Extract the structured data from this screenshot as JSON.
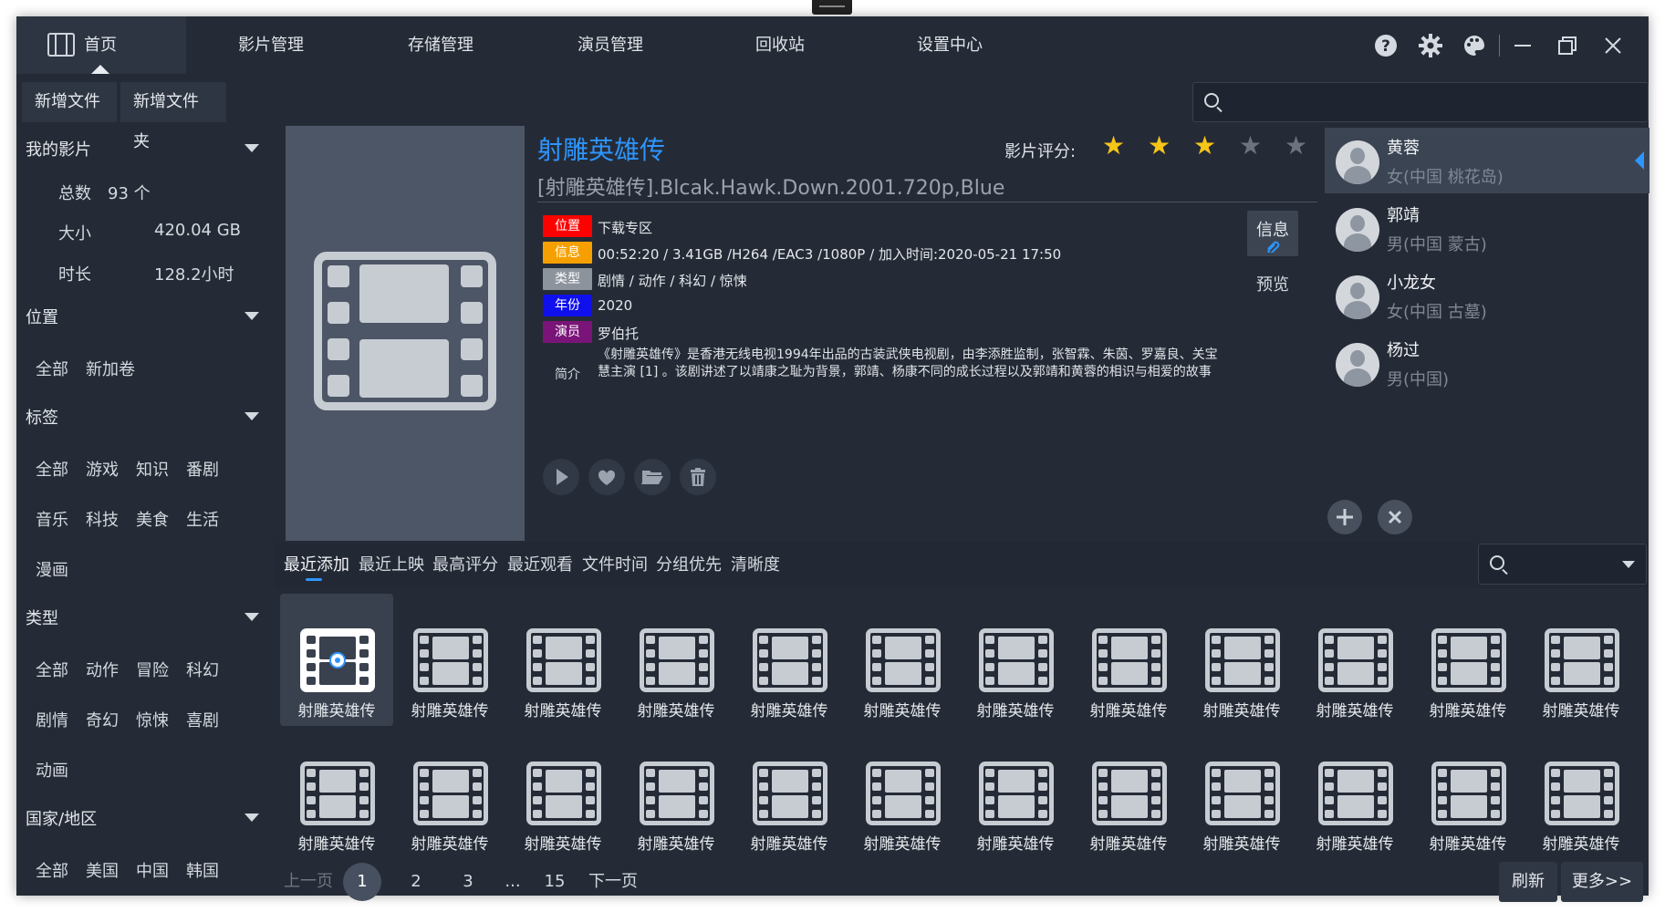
{
  "nav": {
    "home": "首页",
    "tabs": [
      "影片管理",
      "存储管理",
      "演员管理",
      "回收站",
      "设置中心"
    ]
  },
  "toolbar": {
    "new_file": "新增文件",
    "new_folder": "新增文件夹"
  },
  "sidebar": {
    "my_movies": "我的影片",
    "total_label": "总数",
    "total_value": "93 个",
    "size_label": "大小",
    "size_value": "420.04 GB",
    "duration_label": "时长",
    "duration_value": "128.2小时",
    "location": {
      "title": "位置",
      "items": [
        "全部",
        "新加卷"
      ]
    },
    "tags": {
      "title": "标签",
      "items": [
        "全部",
        "游戏",
        "知识",
        "番剧",
        "音乐",
        "科技",
        "美食",
        "生活",
        "漫画"
      ]
    },
    "genres": {
      "title": "类型",
      "items": [
        "全部",
        "动作",
        "冒险",
        "科幻",
        "剧情",
        "奇幻",
        "惊悚",
        "喜剧",
        "动画"
      ]
    },
    "regions": {
      "title": "国家/地区",
      "items": [
        "全部",
        "美国",
        "中国",
        "韩国"
      ]
    }
  },
  "movie": {
    "title": "射雕英雄传",
    "filename": "[射雕英雄传].Blcak.Hawk.Down.2001.720p,Blue",
    "rating_label": "影片评分:",
    "rating": 3,
    "rating_max": 5,
    "info": [
      {
        "tag": "位置",
        "color": "#ff0000",
        "value": "下载专区"
      },
      {
        "tag": "信息",
        "color": "#f5a000",
        "value": "00:52:20 / 3.41GB /H264 /EAC3 /1080P / 加入时间:2020-05-21 17:50"
      },
      {
        "tag": "类型",
        "color": "#8c939c",
        "value": "剧情 / 动作 / 科幻 / 惊悚"
      },
      {
        "tag": "年份",
        "color": "#1010ee",
        "value": "2020"
      },
      {
        "tag": "演员",
        "color": "#7a1478",
        "value": "罗伯托"
      }
    ],
    "summary_label": "简介",
    "summary": "《射雕英雄传》是香港无线电视1994年出品的古装武侠电视剧，由李添胜监制，张智霖、朱茵、罗嘉良、关宝慧主演 [1] 。该剧讲述了以靖康之耻为背景，郭靖、杨康不同的成长过程以及郭靖和黄蓉的相识与相爱的故事",
    "info_button": "信息",
    "preview": "预览"
  },
  "actors": [
    {
      "name": "黄蓉",
      "meta": "女(中国 桃花岛)"
    },
    {
      "name": "郭靖",
      "meta": "男(中国 蒙古)"
    },
    {
      "name": "小龙女",
      "meta": "女(中国 古墓)"
    },
    {
      "name": "杨过",
      "meta": "男(中国)"
    }
  ],
  "sort_tabs": [
    "最近添加",
    "最近上映",
    "最高评分",
    "最近观看",
    "文件时间",
    "分组优先",
    "清晰度"
  ],
  "grid_item_label": "射雕英雄传",
  "pagination": {
    "prev": "上一页",
    "pages": [
      "1",
      "2",
      "3",
      "...",
      "15"
    ],
    "next": "下一页"
  },
  "bottom": {
    "refresh": "刷新",
    "more": "更多>>"
  },
  "colors": {
    "accent": "#2d95ff",
    "star_on": "#f5c518",
    "star_off": "#6b7380"
  }
}
